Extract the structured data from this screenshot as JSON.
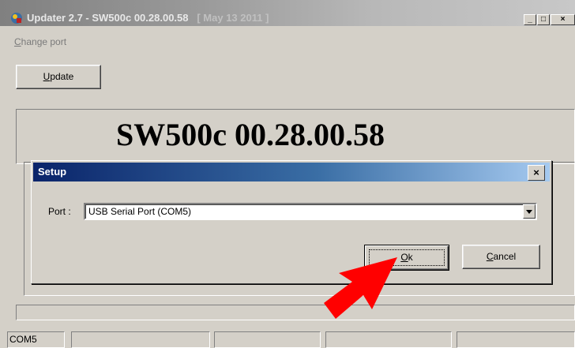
{
  "window": {
    "title_main": "Updater 2.7 - SW500c 00.28.00.58",
    "title_date": "[ May 13 2011 ]",
    "min_glyph": "_",
    "max_glyph": "□",
    "close_glyph": "×"
  },
  "menu": {
    "change_port_first": "C",
    "change_port_rest": "hange port"
  },
  "main": {
    "update_first": "U",
    "update_rest": "pdate",
    "version": "SW500c 00.28.00.58"
  },
  "dialog": {
    "title": "Setup",
    "close_glyph": "×",
    "port_label": "Port :",
    "port_value": "USB Serial Port (COM5)",
    "ok_first": "O",
    "ok_rest": "k",
    "cancel_first": "C",
    "cancel_rest": "ancel"
  },
  "statusbar": {
    "panel1": "COM5",
    "panel2": "",
    "panel3": "",
    "panel4": "",
    "panel5": ""
  },
  "colors": {
    "annotation_arrow": "#ff0000",
    "dialog_title_start": "#0a246a",
    "dialog_title_end": "#a6caf0"
  }
}
